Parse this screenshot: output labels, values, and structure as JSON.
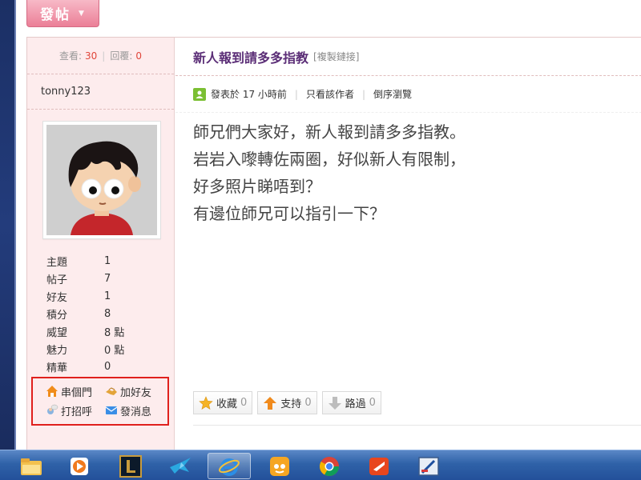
{
  "post_button": {
    "label": "發帖"
  },
  "stats": {
    "views_label": "查看:",
    "views": "30",
    "replies_label": "回覆:",
    "replies": "0"
  },
  "user": {
    "name": "tonny123"
  },
  "profile": [
    {
      "label": "主題",
      "value": "1"
    },
    {
      "label": "帖子",
      "value": "7"
    },
    {
      "label": "好友",
      "value": "1"
    },
    {
      "label": "積分",
      "value": "8"
    },
    {
      "label": "威望",
      "value": "8 點"
    },
    {
      "label": "魅力",
      "value": "0 點"
    },
    {
      "label": "精華",
      "value": "0"
    }
  ],
  "actions": {
    "visit": "串個門",
    "add_friend": "加好友",
    "greet": "打招呼",
    "message": "發消息"
  },
  "thread": {
    "title": "新人報到請多多指教",
    "copy_link": "[複製鏈接]",
    "posted": "發表於 17 小時前",
    "only_author": "只看該作者",
    "reverse": "倒序瀏覽",
    "body": [
      "師兄們大家好，新人報到請多多指教。",
      "岩岩入嚟轉佐兩圈，好似新人有限制，",
      "好多照片睇唔到？",
      "有邊位師兄可以指引一下？"
    ]
  },
  "votes": {
    "collect_label": "收藏",
    "collect_count": "0",
    "support_label": "支持",
    "support_count": "0",
    "pass_label": "路過",
    "pass_count": "0"
  },
  "taskbar": {
    "apps": [
      "file-explorer-icon",
      "media-player-icon",
      "league-icon",
      "bird-app-icon",
      "internet-explorer-icon",
      "pps-icon",
      "chrome-icon",
      "app-red-icon",
      "paint-app-icon"
    ]
  },
  "colors": {
    "accent": "#e0463a",
    "title": "#5b2e77",
    "sidebar_bg": "#fdeced",
    "highlight_border": "#e0201d"
  }
}
